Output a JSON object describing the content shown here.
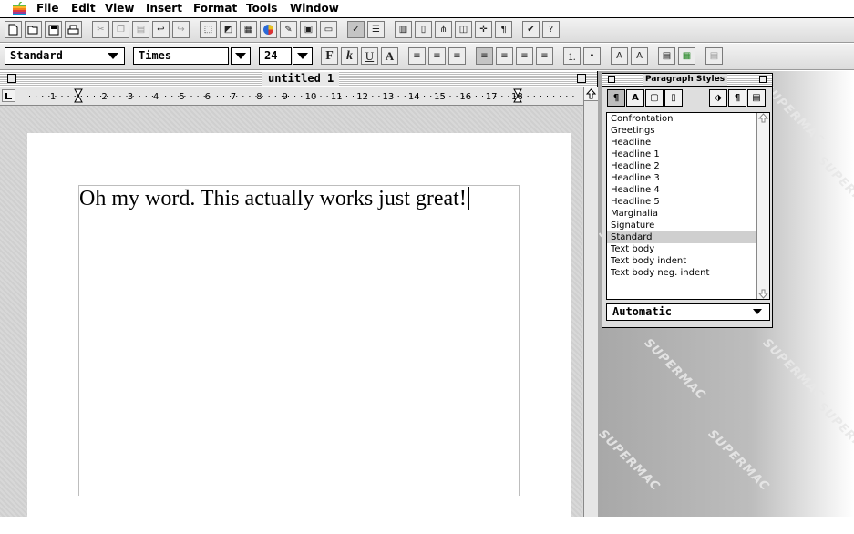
{
  "menubar": {
    "items": [
      "File",
      "Edit",
      "View",
      "Insert",
      "Format",
      "Tools",
      "Window"
    ]
  },
  "toolbar2": {
    "paragraph_style": "Standard",
    "font_name": "Times",
    "font_size": "24",
    "bold_label": "F",
    "italic_label": "k",
    "underline_label": "U"
  },
  "document": {
    "title": "untitled 1",
    "text": "Oh my word. This actually works just great!",
    "ruler_labels": [
      "1",
      "1",
      "2",
      "3",
      "4",
      "5",
      "6",
      "7",
      "8",
      "9",
      "10",
      "11",
      "12",
      "13",
      "14",
      "15",
      "16",
      "17",
      "18"
    ]
  },
  "palette": {
    "title": "Paragraph Styles",
    "styles": [
      "Confrontation",
      "Greetings",
      "Headline",
      "Headline 1",
      "Headline 2",
      "Headline 3",
      "Headline 4",
      "Headline 5",
      "Marginalia",
      "Signature",
      "Standard",
      "Text body",
      "Text body indent",
      "Text body neg. indent"
    ],
    "selected_style": "Standard",
    "filter": "Automatic"
  },
  "desktop": {
    "watermark": "SUPERMAC"
  }
}
